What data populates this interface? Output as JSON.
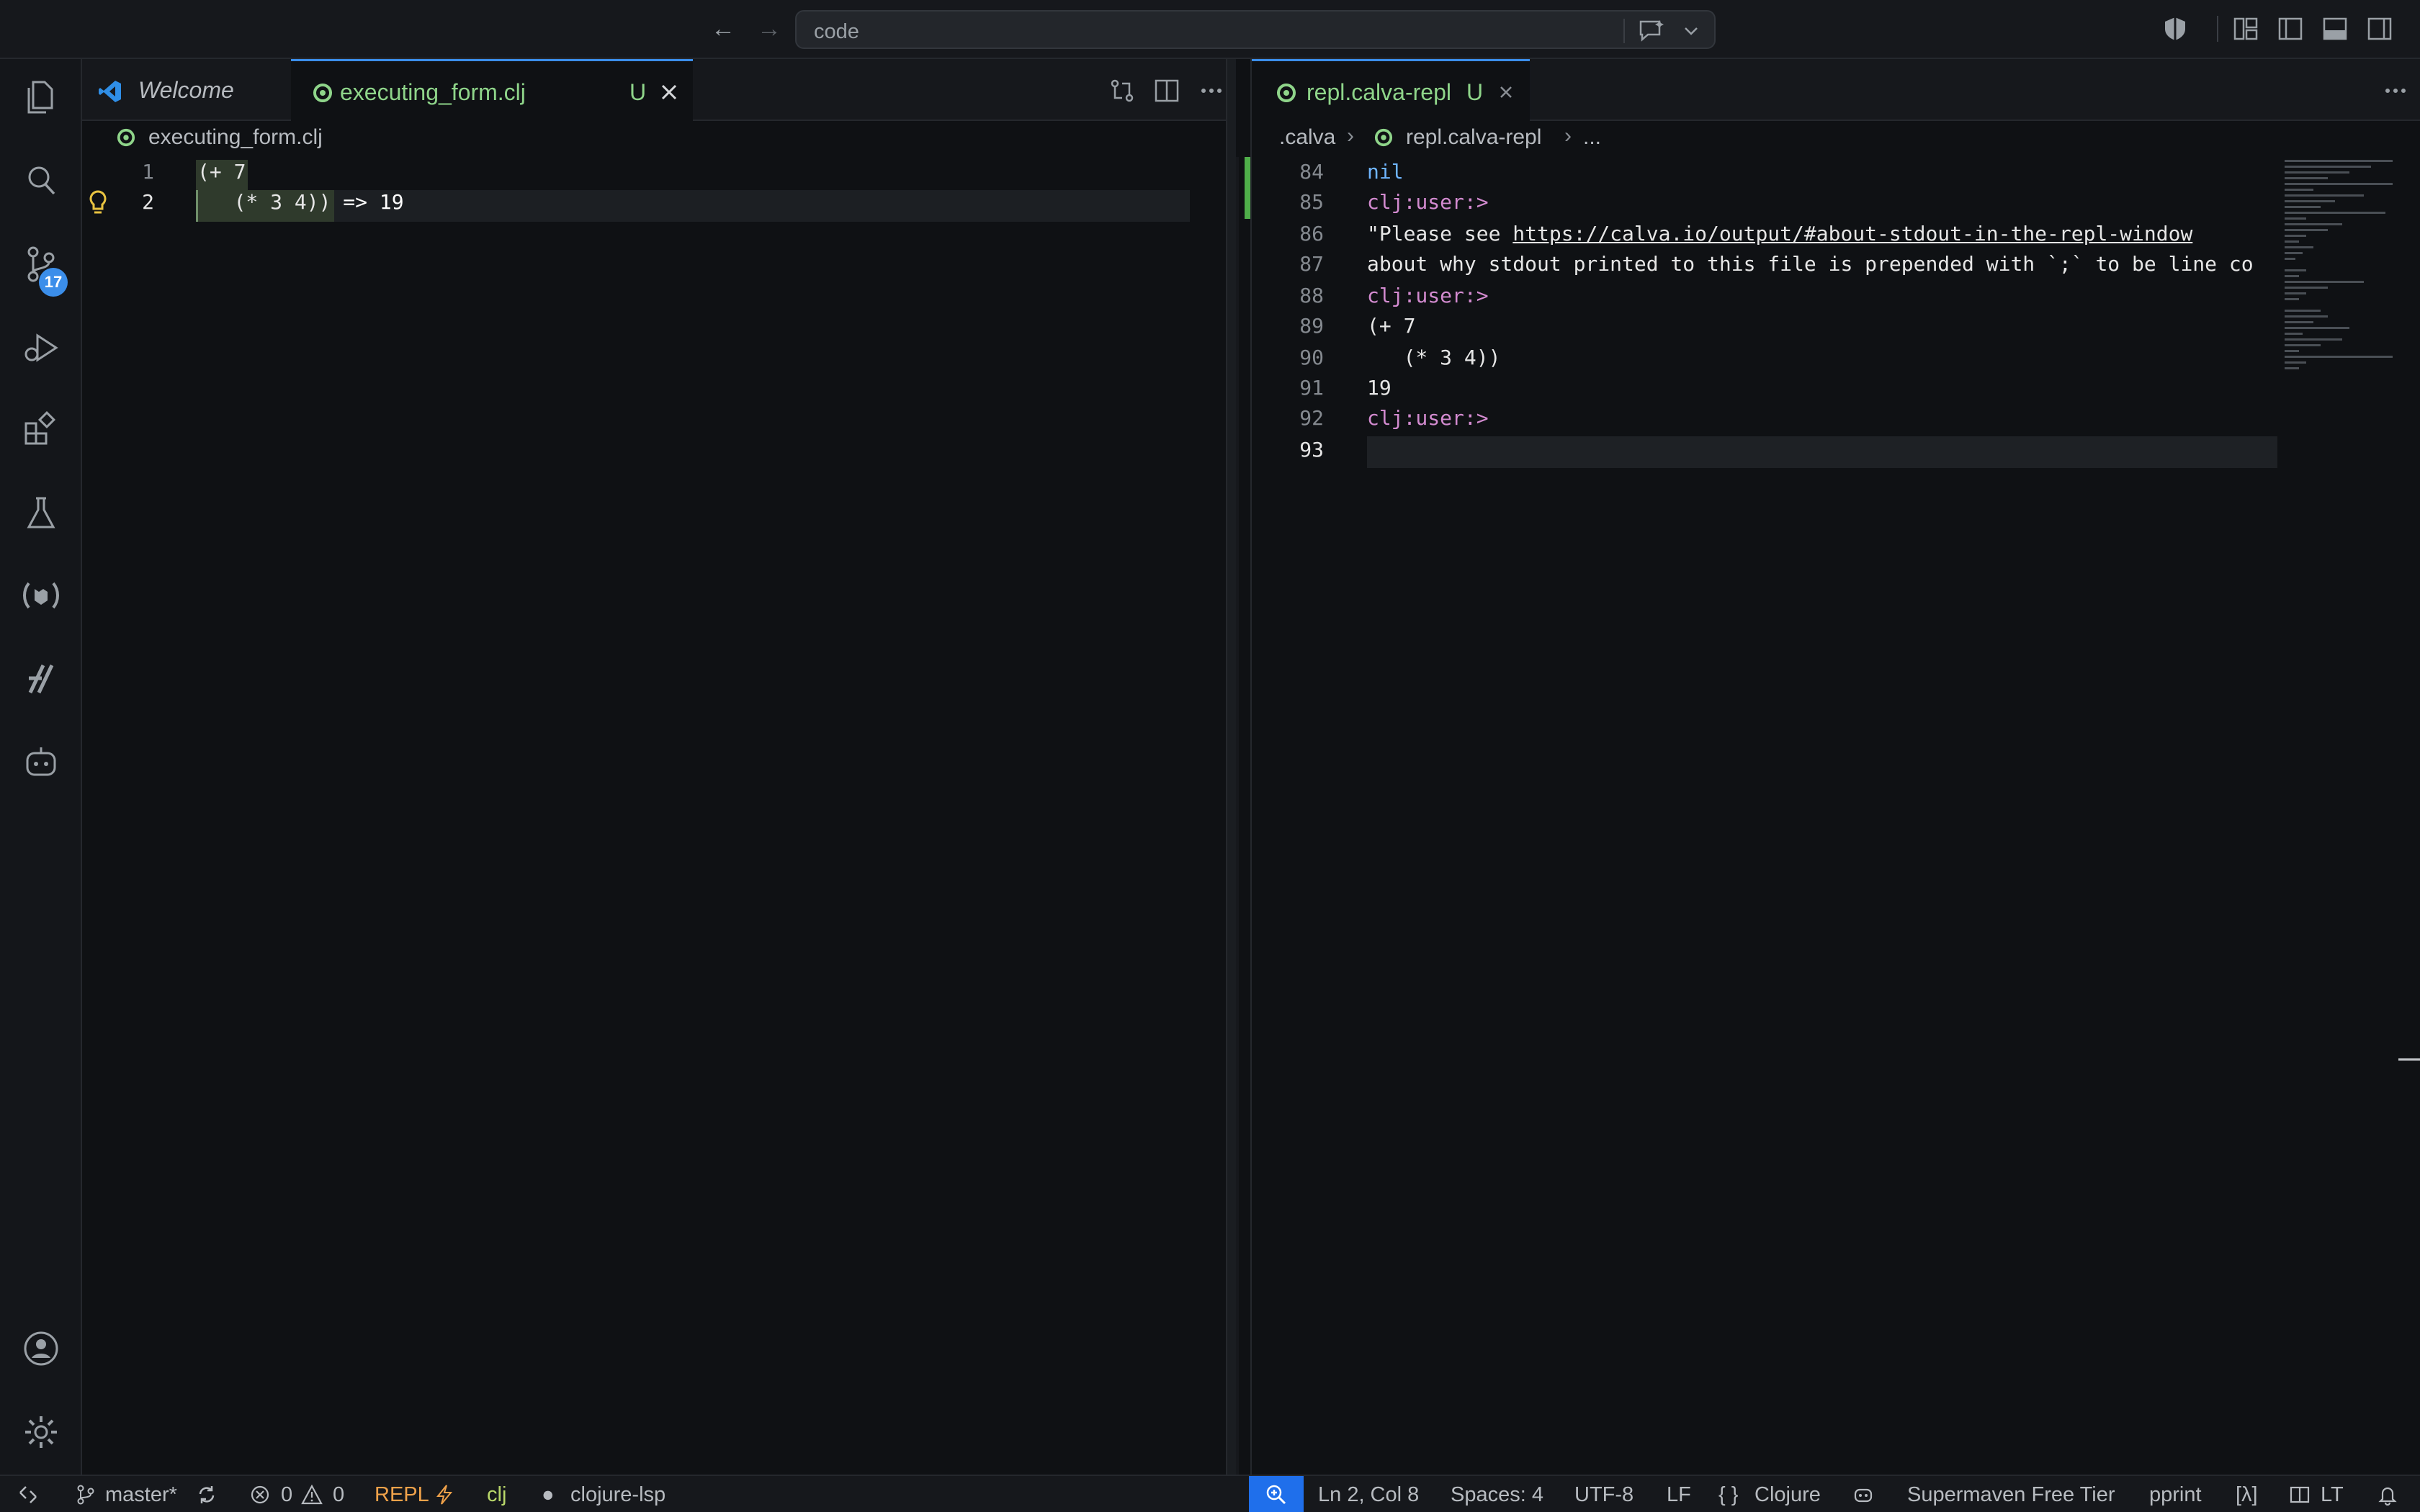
{
  "titlebar": {
    "search_text": "code"
  },
  "activity_bar": {
    "items": [
      "explorer",
      "search",
      "source-control",
      "run-and-debug",
      "extensions",
      "testing",
      "calva",
      "supermaven",
      "copilot-chat"
    ],
    "scm_badge": "17"
  },
  "editor1": {
    "tabs": [
      {
        "label": "Welcome",
        "active": false
      },
      {
        "label": "executing_form.clj",
        "status": "U",
        "active": true
      }
    ],
    "breadcrumb": "executing_form.clj",
    "lines": [
      {
        "num": "1",
        "text": "(+ 7"
      },
      {
        "num": "2",
        "text": "   (* 3 4))",
        "inline_result": " => 19"
      }
    ]
  },
  "editor2": {
    "tabs": [
      {
        "label": "repl.calva-repl",
        "status": "U",
        "active": true
      }
    ],
    "breadcrumb": [
      ".calva",
      "repl.calva-repl",
      "..."
    ],
    "lines": [
      {
        "num": "84",
        "text": "nil"
      },
      {
        "num": "85",
        "text": "clj:user:>"
      },
      {
        "num": "86",
        "text_prefix": "\"Please see ",
        "link": "https://calva.io/output/#about-stdout-in-the-repl-window"
      },
      {
        "num": "87",
        "text": "about why stdout printed to this file is prepended with `;` to be line co"
      },
      {
        "num": "88",
        "text": "clj:user:>"
      },
      {
        "num": "89",
        "text": "(+ 7"
      },
      {
        "num": "90",
        "text": "   (* 3 4))"
      },
      {
        "num": "91",
        "text": "19"
      },
      {
        "num": "92",
        "text": "clj:user:>"
      },
      {
        "num": "93",
        "text": ""
      }
    ]
  },
  "statusbar": {
    "branch": "master*",
    "errors": "0",
    "warnings": "0",
    "repl": "REPL",
    "clj": "clj",
    "lsp": "clojure-lsp",
    "position": "Ln 2, Col 8",
    "spaces": "Spaces: 4",
    "encoding": "UTF-8",
    "eol": "LF",
    "language": "Clojure",
    "supermaven": "Supermaven Free Tier",
    "pprint": "pprint",
    "lambda": "[λ]",
    "lt": "LT"
  },
  "colors": {
    "accent": "#3b8eea",
    "untracked": "#8fd58a",
    "prompt": "#d38bd0",
    "repl_status": "#f0a24a"
  }
}
